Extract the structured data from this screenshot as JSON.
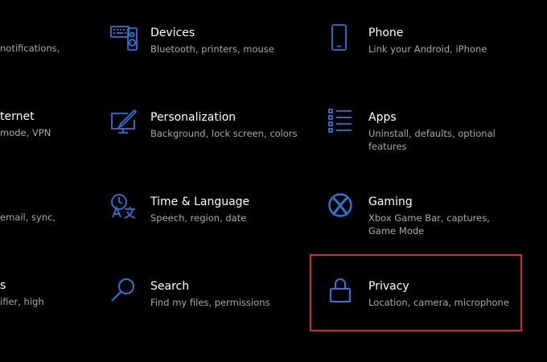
{
  "colors": {
    "background": "#000000",
    "accent": "#2f74d6",
    "title": "#ffffff",
    "description": "#a9a9a9",
    "highlight": "#d12b2b"
  },
  "left_column_partial": [
    {
      "title": "",
      "desc": "notifications,"
    },
    {
      "title": "ternet",
      "desc": "mode, VPN"
    },
    {
      "title": "",
      "desc": "email, sync,"
    },
    {
      "title": "s",
      "desc": "ifier, high"
    }
  ],
  "tiles": {
    "devices": {
      "title": "Devices",
      "desc": "Bluetooth, printers, mouse",
      "icon": "keyboard-speaker-icon"
    },
    "phone": {
      "title": "Phone",
      "desc": "Link your Android, iPhone",
      "icon": "phone-icon"
    },
    "personalization": {
      "title": "Personalization",
      "desc": "Background, lock screen, colors",
      "icon": "monitor-pen-icon"
    },
    "apps": {
      "title": "Apps",
      "desc": "Uninstall, defaults, optional features",
      "icon": "apps-list-icon"
    },
    "time_language": {
      "title": "Time & Language",
      "desc": "Speech, region, date",
      "icon": "clock-language-icon"
    },
    "gaming": {
      "title": "Gaming",
      "desc": "Xbox Game Bar, captures, Game Mode",
      "icon": "xbox-icon"
    },
    "search": {
      "title": "Search",
      "desc": "Find my files, permissions",
      "icon": "search-icon"
    },
    "privacy": {
      "title": "Privacy",
      "desc": "Location, camera, microphone",
      "icon": "lock-icon"
    }
  }
}
